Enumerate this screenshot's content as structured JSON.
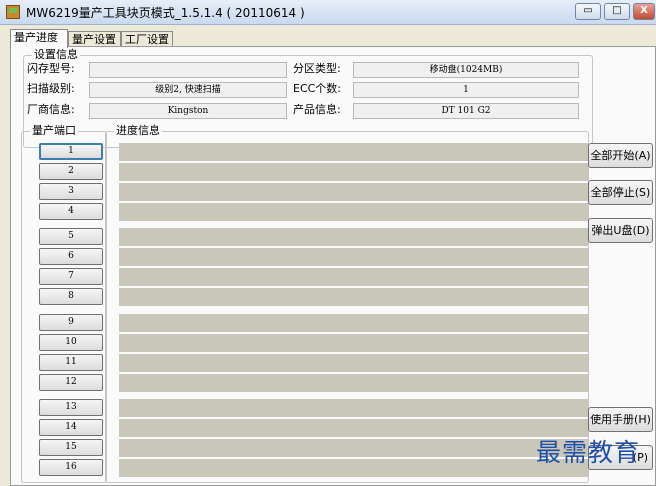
{
  "window": {
    "title": "MW6219量产工具块页模式_1.5.1.4 ( 20110614 )",
    "minimize_glyph": "▭",
    "maximize_glyph": "□",
    "close_glyph": "X"
  },
  "tabs": [
    "量产进度",
    "量产设置",
    "工厂设置"
  ],
  "settings": {
    "group_label": "设置信息",
    "flash_model_label": "闪存型号:",
    "flash_model_value": "",
    "partition_type_label": "分区类型:",
    "partition_type_value": "移动盘(1024MB)",
    "scan_level_label": "扫描级别:",
    "scan_level_value": "级别2, 快速扫描",
    "ecc_label": "ECC个数:",
    "ecc_value": "1",
    "vendor_label": "厂商信息:",
    "vendor_value": "Kingston",
    "product_label": "产品信息:",
    "product_value": "DT 101 G2"
  },
  "ports": {
    "group_label": "量产端口",
    "items": [
      "1",
      "2",
      "3",
      "4",
      "5",
      "6",
      "7",
      "8",
      "9",
      "10",
      "11",
      "12",
      "13",
      "14",
      "15",
      "16"
    ]
  },
  "progress": {
    "group_label": "进度信息",
    "bar_fill": [
      0,
      0,
      0,
      0,
      0,
      0,
      0,
      0,
      0,
      0,
      0,
      0,
      0,
      0,
      0,
      0
    ]
  },
  "actions": {
    "start_all": "全部开始(A)",
    "stop_all": "全部停止(S)",
    "eject": "弹出U盘(D)",
    "manual": "使用手册(H)",
    "last_partial": "(P)"
  },
  "watermark": "最需教育",
  "colors": {
    "bar": "#c9c7b9",
    "panel": "#fafafa",
    "watermark": "#1f4fa8"
  }
}
